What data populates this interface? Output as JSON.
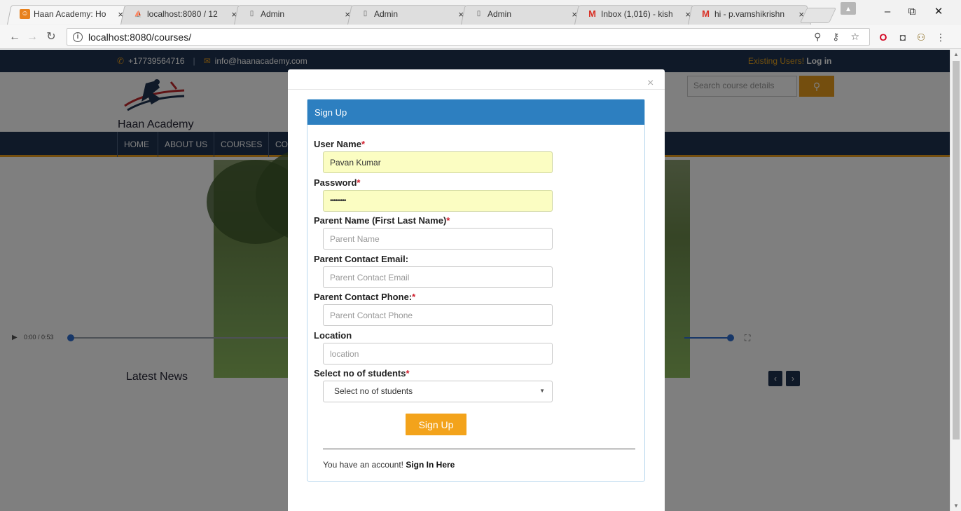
{
  "browser": {
    "tabs": [
      {
        "title": "Haan Academy: Ho",
        "active": true,
        "icon": "haan-favicon"
      },
      {
        "title": "localhost:8080 / 12",
        "active": false,
        "icon": "phpmyadmin-favicon"
      },
      {
        "title": "Admin",
        "active": false,
        "icon": "page-icon"
      },
      {
        "title": "Admin",
        "active": false,
        "icon": "page-icon"
      },
      {
        "title": "Admin",
        "active": false,
        "icon": "page-icon"
      },
      {
        "title": "Inbox (1,016) - kish",
        "active": false,
        "icon": "gmail-icon"
      },
      {
        "title": "hi - p.vamshikrishn",
        "active": false,
        "icon": "gmail-icon"
      }
    ],
    "tab_close": "×",
    "url": "localhost:8080/courses/",
    "window_controls": {
      "minimize": "–",
      "restore": "⧉",
      "close": "✕"
    }
  },
  "site": {
    "phone": "+17739564716",
    "email": "info@haanacademy.com",
    "login_prefix": "Existing Users!",
    "login_link": "Log in",
    "brand": "Haan Academy",
    "search_placeholder": "Search course details",
    "nav": [
      "HOME",
      "ABOUT US",
      "COURSES",
      "CO"
    ],
    "video_time": "0:00 / 0:53",
    "latest_news": "Latest News",
    "pager_prev": "‹",
    "pager_next": "›"
  },
  "modal": {
    "close": "×",
    "heading": "Sign Up",
    "fields": {
      "username": {
        "label": "User Name",
        "required": "*",
        "value": "Pavan Kumar"
      },
      "password": {
        "label": "Password",
        "required": "*",
        "value": "•••••••••"
      },
      "parent_name": {
        "label": "Parent Name (First Last Name)",
        "required": "*",
        "placeholder": "Parent Name"
      },
      "parent_email": {
        "label": "Parent Contact Email:",
        "placeholder": "Parent Contact Email"
      },
      "parent_phone": {
        "label": "Parent Contact Phone:",
        "required": "*",
        "placeholder": "Parent Contact Phone"
      },
      "location": {
        "label": "Location",
        "placeholder": "location"
      },
      "students": {
        "label": "Select no of students",
        "required": "*",
        "selected": "Select no of students"
      }
    },
    "submit": "Sign Up",
    "signin_prefix": "You have an account!",
    "signin_link": "Sign In Here"
  },
  "colors": {
    "navy": "#1f3350",
    "orange": "#f3a31b",
    "panel_blue": "#2d7fc0",
    "autofill": "#fbfdc2"
  }
}
